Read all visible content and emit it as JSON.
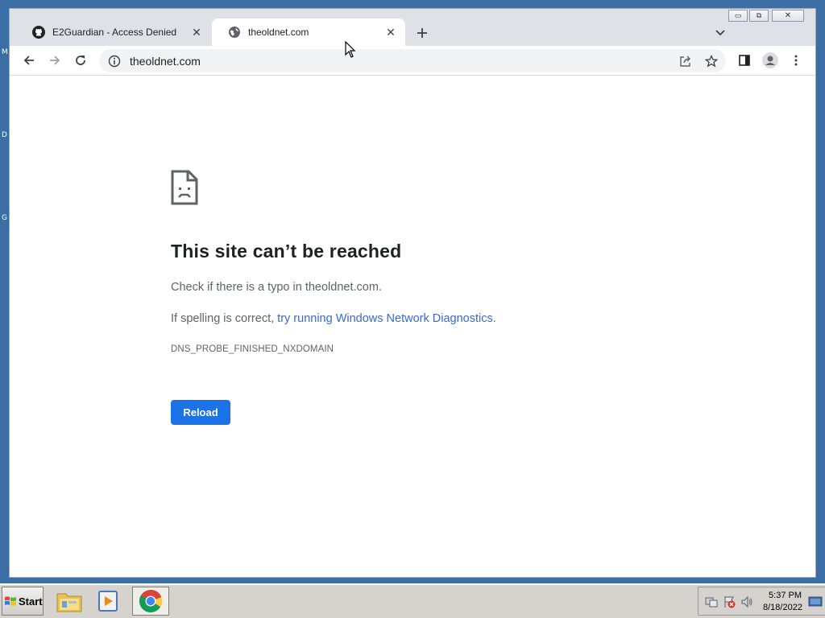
{
  "desktop": {
    "fragments": [
      "M",
      "D",
      "G"
    ]
  },
  "window": {
    "controls": {
      "minimize": "▭",
      "restore": "⧉",
      "close": "✕"
    }
  },
  "tabs": [
    {
      "title": "E2Guardian - Access Denied",
      "icon": "github-icon",
      "active": false
    },
    {
      "title": "theoldnet.com",
      "icon": "globe-icon",
      "active": true
    }
  ],
  "toolbar": {
    "url": "theoldnet.com"
  },
  "error_page": {
    "title": "This site can’t be reached",
    "line1": "Check if there is a typo in theoldnet.com.",
    "line2_prefix": "If spelling is correct, ",
    "line2_link": "try running Windows Network Diagnostics",
    "line2_suffix": ".",
    "code": "DNS_PROBE_FINISHED_NXDOMAIN",
    "reload_label": "Reload"
  },
  "taskbar": {
    "start_label": "Start",
    "apps": [
      "file-explorer-icon",
      "media-player-icon",
      "chrome-icon"
    ],
    "time": "5:37 PM",
    "date": "8/18/2022"
  },
  "colors": {
    "desktop": "#3a6ea5",
    "accent": "#1a73e8",
    "link": "#3869d4"
  }
}
